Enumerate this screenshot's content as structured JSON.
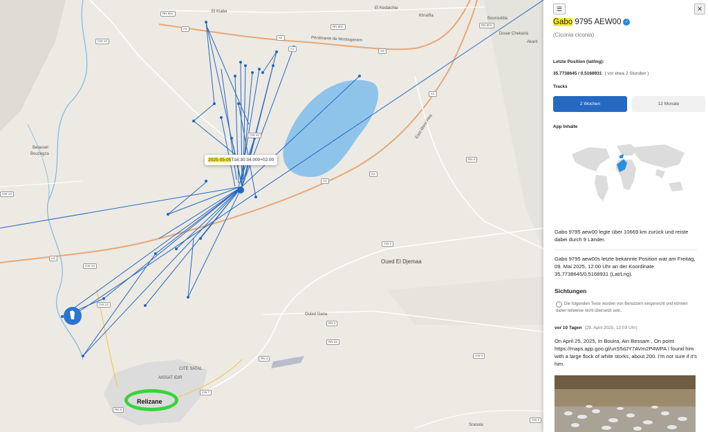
{
  "map": {
    "places": {
      "el_kiaba": "El Kiaba",
      "el_kedaichia": "El Kedaichia",
      "khraifia": "Khraïfia",
      "bouroukba": "Bouroukba",
      "douar_chekaria": "Douar Chekaria",
      "akarit": "Akarit",
      "penetrante": "Pénétrante de Mostaganem",
      "belassel": "Belassel",
      "bouzegza": "Bouzegza",
      "oued_el_djemaa": "Oued El Djemaa",
      "ouled_gana": "Ouled Gana",
      "cite_satal": "CITÉ SATAL",
      "aissat_idir": "AISSAT IDIR",
      "sraouia": "Sraouia",
      "east_west_hwy": "East-West Hwy"
    },
    "road_shields": [
      "RN 90A",
      "RN 90A",
      "CW 12",
      "A4",
      "A4",
      "A4",
      "RN 90A",
      "A1",
      "CW 12",
      "A1",
      "CW 13",
      "RN 4",
      "CW 2",
      "A3",
      "CW 13",
      "A3",
      "CW 13",
      "RN 4",
      "RN 23",
      "CW 3",
      "RN 4",
      "RN 6",
      "CW 2",
      "CW 7",
      "A1"
    ],
    "tooltip": {
      "date": "2025-05-05",
      "rest": "T16:30:34.000+02:00"
    },
    "highlight_label": "Relizane"
  },
  "panel": {
    "menu_icon": "list-icon",
    "close_icon": "close-icon",
    "title_name": "Gabo",
    "title_rest": " 9795 AEW00",
    "scientific_name": "(Ciconia ciconia)",
    "letzte_label": "Letzte Position (lat/lng):",
    "coords": "35.7738645 / 0.5168931",
    "coords_ago": "( vor etwa 2 Stunden )",
    "tracks_label": "Tracks",
    "track_buttons": [
      "2 Wochen",
      "12 Monate"
    ],
    "app_inhalte_label": "App Inhalte",
    "summary": "Gabo 9795 aew00 legte über 10669 km zurück und reiste dabei durch 9 Länder.",
    "last_position_text": "Gabo 9795 aew00s letzte bekannte Position war am Freitag, 09. Mai 2025, 12:00 Uhr an der Koordinate 35.7738645/0.5168931 (Lat/Lng).",
    "sichtungen_label": "Sichtungen",
    "notice": "Die folgenden Texte wurden von Benutzern eingereicht und können daher teilweise nicht übersetzt sein.",
    "sighting_ago": "vor 10 Tagen",
    "sighting_date": "(29. April 2025, 12:03 Uhr)",
    "sighting_text": "On April 25, 2025, In Bouira, Ain Bessam , On point https://maps.app.goo.gl/unS5dJY7AVm2P4WPA I found him with a large flock of white storks, about 200. I'm not sure if it's him."
  },
  "colors": {
    "track": "#2367c4",
    "lake": "#8ec4ea",
    "highlight_ring": "#37d43a",
    "active_button": "#2569c3"
  }
}
